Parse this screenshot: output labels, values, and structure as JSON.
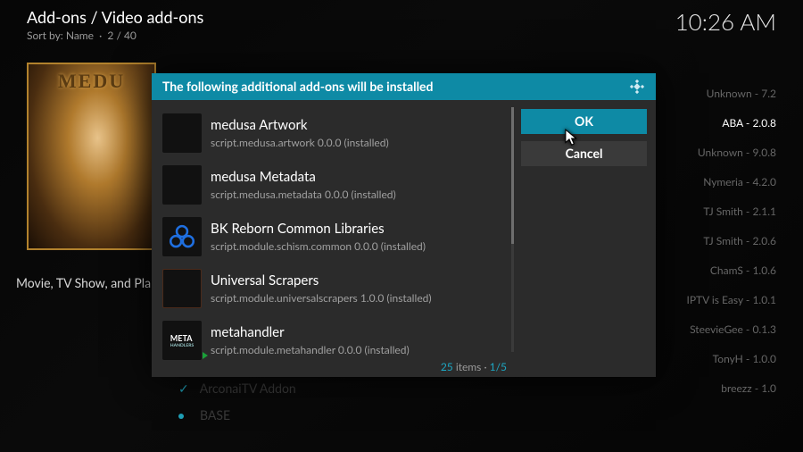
{
  "header": {
    "breadcrumb": "Add-ons / Video add-ons",
    "sort_label": "Sort by: Name",
    "pager": "2 / 40",
    "clock": "10:26 AM"
  },
  "poster": {
    "title": "MEDU"
  },
  "addon_tagline": "Movie, TV Show, and Pla",
  "sidebar": {
    "items": [
      {
        "name": "Unknown",
        "ver": "7.2",
        "selected": false
      },
      {
        "name": "ABA",
        "ver": "2.0.8",
        "selected": true
      },
      {
        "name": "Unknown",
        "ver": "9.0.8",
        "selected": false
      },
      {
        "name": "Nymeria",
        "ver": "4.2.0",
        "selected": false
      },
      {
        "name": "TJ Smith",
        "ver": "2.1.1",
        "selected": false
      },
      {
        "name": "TJ Smith",
        "ver": "2.0.6",
        "selected": false
      },
      {
        "name": "ChamS",
        "ver": "1.0.6",
        "selected": false
      },
      {
        "name": "IPTV is Easy",
        "ver": "1.0.1",
        "selected": false
      },
      {
        "name": "SteevieGee",
        "ver": "0.1.3",
        "selected": false
      },
      {
        "name": "TonyH",
        "ver": "1.0.0",
        "selected": false
      },
      {
        "name": "breezz",
        "ver": "1.0",
        "selected": false
      }
    ]
  },
  "bg_list": {
    "items": [
      {
        "label": "ArconaiTV Addon",
        "checked": true
      },
      {
        "label": "BASE",
        "checked": false
      }
    ]
  },
  "dialog": {
    "title": "The following additional add-ons will be installed",
    "ok_label": "OK",
    "cancel_label": "Cancel",
    "items_word": "items",
    "count": "25",
    "page": "1/5",
    "addons": [
      {
        "name": "medusa Artwork",
        "meta": "script.medusa.artwork 0.0.0 (installed)",
        "icon": "medusa"
      },
      {
        "name": "medusa Metadata",
        "meta": "script.medusa.metadata 0.0.0 (installed)",
        "icon": "medusa"
      },
      {
        "name": "BK Reborn Common Libraries",
        "meta": "script.module.schism.common 0.0.0 (installed)",
        "icon": "bk"
      },
      {
        "name": "Universal Scrapers",
        "meta": "script.module.universalscrapers 1.0.0 (installed)",
        "icon": "univ"
      },
      {
        "name": "metahandler",
        "meta": "script.module.metahandler 0.0.0 (installed)",
        "icon": "meta"
      }
    ]
  }
}
